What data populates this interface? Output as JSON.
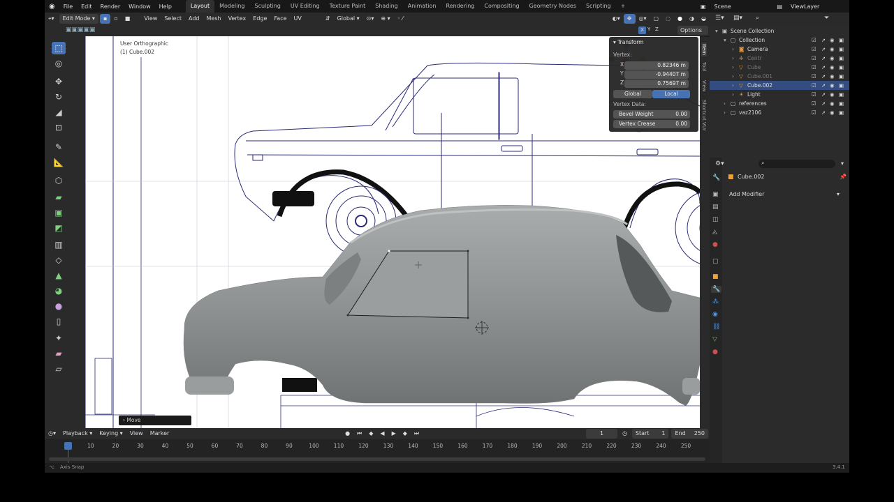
{
  "topbar": {
    "menus": [
      "File",
      "Edit",
      "Render",
      "Window",
      "Help"
    ],
    "workspaces": [
      "Layout",
      "Modeling",
      "Sculpting",
      "UV Editing",
      "Texture Paint",
      "Shading",
      "Animation",
      "Rendering",
      "Compositing",
      "Geometry Nodes",
      "Scripting"
    ],
    "active_workspace": "Layout",
    "scene": "Scene",
    "view_layer": "ViewLayer"
  },
  "header3d": {
    "mode": "Edit Mode",
    "menus": [
      "View",
      "Select",
      "Add",
      "Mesh",
      "Vertex",
      "Edge",
      "Face",
      "UV"
    ],
    "orientation": "Global",
    "axes": [
      "X",
      "Y",
      "Z"
    ],
    "options": "Options"
  },
  "viewport": {
    "view_name": "User Orthographic",
    "object_name": "(1) Cube.002",
    "operator_panel": "Move"
  },
  "transform_panel": {
    "title": "Transform",
    "vertex_label": "Vertex:",
    "x_label": "X",
    "x_value": "0.82346 m",
    "y_label": "Y",
    "y_value": "-0.94407 m",
    "z_label": "Z",
    "z_value": "0.75697 m",
    "global": "Global",
    "local": "Local",
    "vertex_data_label": "Vertex Data:",
    "bevel_weight_label": "Bevel Weight",
    "bevel_weight_value": "0.00",
    "vertex_crease_label": "Vertex Crease",
    "vertex_crease_value": "0.00"
  },
  "sidetabs": [
    "Item",
    "Tool",
    "View",
    "Shortcut VUr"
  ],
  "outliner": {
    "rows": [
      {
        "label": "Scene Collection",
        "indent": 0,
        "icon": "scene-collection-icon"
      },
      {
        "label": "Collection",
        "indent": 1,
        "icon": "collection-icon"
      },
      {
        "label": "Camera",
        "indent": 2,
        "icon": "camera-icon"
      },
      {
        "label": "Centr",
        "indent": 2,
        "icon": "empty-icon"
      },
      {
        "label": "Cube",
        "indent": 2,
        "icon": "mesh-icon"
      },
      {
        "label": "Cube.001",
        "indent": 2,
        "icon": "mesh-icon"
      },
      {
        "label": "Cube.002",
        "indent": 2,
        "icon": "mesh-icon"
      },
      {
        "label": "Light",
        "indent": 2,
        "icon": "light-icon"
      },
      {
        "label": "references",
        "indent": 1,
        "icon": "collection-icon"
      },
      {
        "label": "vaz2106",
        "indent": 1,
        "icon": "collection-icon"
      }
    ],
    "selected": "Cube.002"
  },
  "properties": {
    "object": "Cube.002",
    "add_modifier": "Add Modifier"
  },
  "timeline": {
    "menus": [
      "Playback",
      "Keying",
      "View",
      "Marker"
    ],
    "current_frame": "1",
    "start_label": "Start",
    "start_value": "1",
    "end_label": "End",
    "end_value": "250",
    "ticks": [
      "1",
      "10",
      "20",
      "30",
      "40",
      "50",
      "60",
      "70",
      "80",
      "90",
      "100",
      "110",
      "120",
      "130",
      "140",
      "150",
      "160",
      "170",
      "180",
      "190",
      "200",
      "210",
      "220",
      "230",
      "240",
      "250"
    ]
  },
  "statusbar": {
    "left": "Axis Snap",
    "version": "3.4.1"
  },
  "colors": {
    "accent": "#4772b3",
    "panel": "#2b2b2b",
    "header": "#2a2a2a",
    "blueprint_line": "#2a2a78",
    "mesh": "#8f9293"
  }
}
